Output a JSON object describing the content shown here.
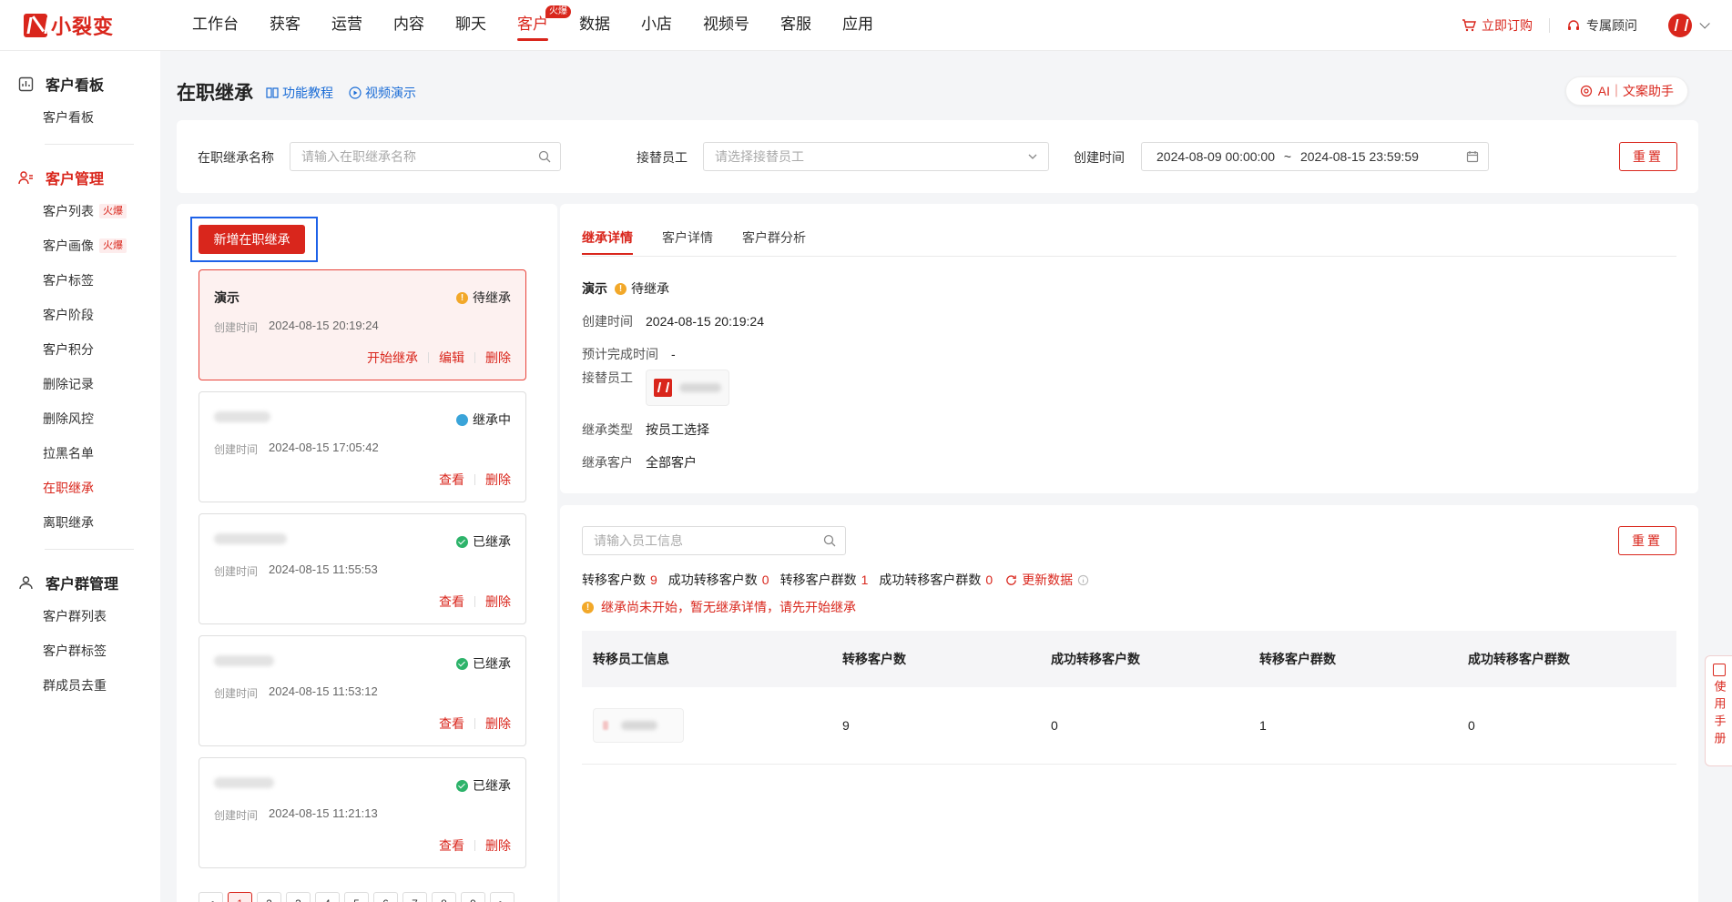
{
  "brand": {
    "name": "小裂变",
    "color": "#d9261c"
  },
  "nav": {
    "items": [
      "工作台",
      "获客",
      "运营",
      "内容",
      "聊天",
      "客户",
      "数据",
      "小店",
      "视频号",
      "客服",
      "应用"
    ],
    "active_index": 5,
    "hot_badge": "火爆",
    "order_label": "立即订购",
    "advisor_label": "专属顾问"
  },
  "sidebar": {
    "board": {
      "title": "客户看板",
      "items": [
        "客户看板"
      ]
    },
    "manage": {
      "title": "客户管理",
      "items": [
        {
          "label": "客户列表",
          "badge": "火爆"
        },
        {
          "label": "客户画像",
          "badge": "火爆"
        },
        {
          "label": "客户标签"
        },
        {
          "label": "客户阶段"
        },
        {
          "label": "客户积分"
        },
        {
          "label": "删除记录"
        },
        {
          "label": "删除风控"
        },
        {
          "label": "拉黑名单"
        },
        {
          "label": "在职继承"
        },
        {
          "label": "离职继承"
        }
      ],
      "active_index": 8
    },
    "group": {
      "title": "客户群管理",
      "items": [
        "客户群列表",
        "客户群标签",
        "群成员去重"
      ]
    }
  },
  "page": {
    "title": "在职继承",
    "tutorial_link": "功能教程",
    "video_link": "视频演示",
    "ai_button": "AI｜文案助手"
  },
  "filters": {
    "name_label": "在职继承名称",
    "name_placeholder": "请输入在职继承名称",
    "staff_label": "接替员工",
    "staff_placeholder": "请选择接替员工",
    "time_label": "创建时间",
    "time_start": "2024-08-09 00:00:00",
    "time_sep": "~",
    "time_end": "2024-08-15 23:59:59",
    "reset": "重置"
  },
  "list": {
    "add_button": "新增在职继承",
    "time_label": "创建时间",
    "cards": [
      {
        "name": "演示",
        "status": "待继承",
        "status_kind": "wait",
        "time": "2024-08-15 20:19:24",
        "actions": [
          "开始继承",
          "编辑",
          "删除"
        ]
      },
      {
        "name": "",
        "status": "继承中",
        "status_kind": "doing",
        "time": "2024-08-15 17:05:42",
        "actions": [
          "查看",
          "删除"
        ]
      },
      {
        "name": "",
        "status": "已继承",
        "status_kind": "done",
        "time": "2024-08-15 11:55:53",
        "actions": [
          "查看",
          "删除"
        ]
      },
      {
        "name": "",
        "status": "已继承",
        "status_kind": "done",
        "time": "2024-08-15 11:53:12",
        "actions": [
          "查看",
          "删除"
        ]
      },
      {
        "name": "",
        "status": "已继承",
        "status_kind": "done",
        "time": "2024-08-15 11:21:13",
        "actions": [
          "查看",
          "删除"
        ]
      }
    ],
    "pages": [
      "<",
      "1",
      "2",
      "3",
      "4",
      "5",
      "6",
      "7",
      "8",
      "9",
      ">"
    ],
    "active_page": "1"
  },
  "detail": {
    "tabs": [
      "继承详情",
      "客户详情",
      "客户群分析"
    ],
    "active_tab": 0,
    "name": "演示",
    "status": "待继承",
    "created_label": "创建时间",
    "created_value": "2024-08-15 20:19:24",
    "eta_label": "预计完成时间",
    "eta_value": "-",
    "staff_label": "接替员工",
    "type_label": "继承类型",
    "type_value": "按员工选择",
    "customers_label": "继承客户",
    "customers_value": "全部客户"
  },
  "data": {
    "search_placeholder": "请输入员工信息",
    "reset": "重置",
    "stats": [
      {
        "label": "转移客户数",
        "value": "9"
      },
      {
        "label": "成功转移客户数",
        "value": "0"
      },
      {
        "label": "转移客户群数",
        "value": "1"
      },
      {
        "label": "成功转移客户群数",
        "value": "0"
      }
    ],
    "refresh": "更新数据",
    "warning": "继承尚未开始，暂无继承详情，请先开始继承",
    "columns": [
      "转移员工信息",
      "转移客户数",
      "成功转移客户数",
      "转移客户群数",
      "成功转移客户群数"
    ],
    "rows": [
      {
        "customers": "9",
        "success_customers": "0",
        "groups": "1",
        "success_groups": "0"
      }
    ]
  },
  "manual": "使用手册"
}
